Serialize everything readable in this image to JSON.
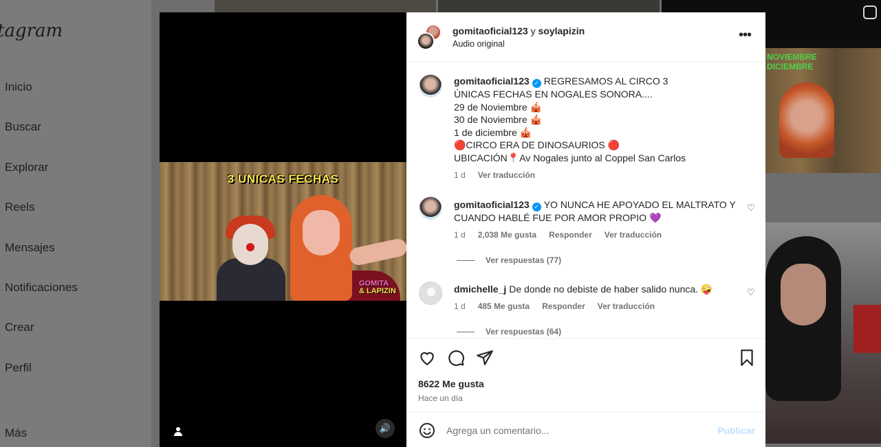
{
  "sidebar": {
    "brand": "tagram",
    "items": [
      {
        "label": "Inicio"
      },
      {
        "label": "Buscar"
      },
      {
        "label": "Explorar"
      },
      {
        "label": "Reels"
      },
      {
        "label": "Mensajes"
      },
      {
        "label": "Notificaciones"
      },
      {
        "label": "Crear"
      },
      {
        "label": "Perfil"
      },
      {
        "label": "Más"
      }
    ]
  },
  "background": {
    "thumb_r1_text": "NOVIEMBRE\nDICIEMBRE"
  },
  "video": {
    "overlay_title": "3 UNICAS FECHAS",
    "logo_line1": "GOMITA",
    "logo_line2": "& LAPIZIN",
    "mute_glyph": "🔊"
  },
  "post": {
    "header": {
      "user1": "gomitaoficial123",
      "joiner": " y ",
      "user2": "soylapizin",
      "audio": "Audio original"
    },
    "caption": {
      "user": "gomitaoficial123",
      "lines": [
        "REGRESAMOS AL CIRCO 3",
        "ÚNICAS FECHAS EN NOGALES SONORA....",
        "29 de Noviembre 🎪",
        "30 de Noviembre 🎪",
        "1 de diciembre 🎪",
        "🔴CIRCO ERA DE DINOSAURIOS 🔴",
        "UBICACIÓN📍Av Nogales junto al Coppel San Carlos"
      ],
      "time": "1 d",
      "translate": "Ver traducción"
    },
    "comments": [
      {
        "user": "gomitaoficial123",
        "verified": true,
        "text": "YO NUNCA HE APOYADO EL MALTRATO Y CUANDO HABLÉ FUE POR AMOR PROPIO 💜",
        "time": "1 d",
        "likes": "2,038 Me gusta",
        "reply": "Responder",
        "translate": "Ver traducción",
        "view_replies": "Ver respuestas (77)"
      },
      {
        "user": "dmichelle_j",
        "verified": false,
        "text": "De donde no debiste de haber salido nunca. 🤪",
        "time": "1 d",
        "likes": "485 Me gusta",
        "reply": "Responder",
        "translate": "Ver traducción",
        "view_replies": "Ver respuestas (64)"
      }
    ],
    "likes": "8622 Me gusta",
    "posted": "Hace un día",
    "composer": {
      "placeholder": "Agrega un comentario...",
      "publish": "Publicar"
    }
  },
  "colors": {
    "accent": "#0095f6",
    "publish_disabled": "#c0dffd",
    "text": "#262626",
    "muted": "#737373"
  }
}
